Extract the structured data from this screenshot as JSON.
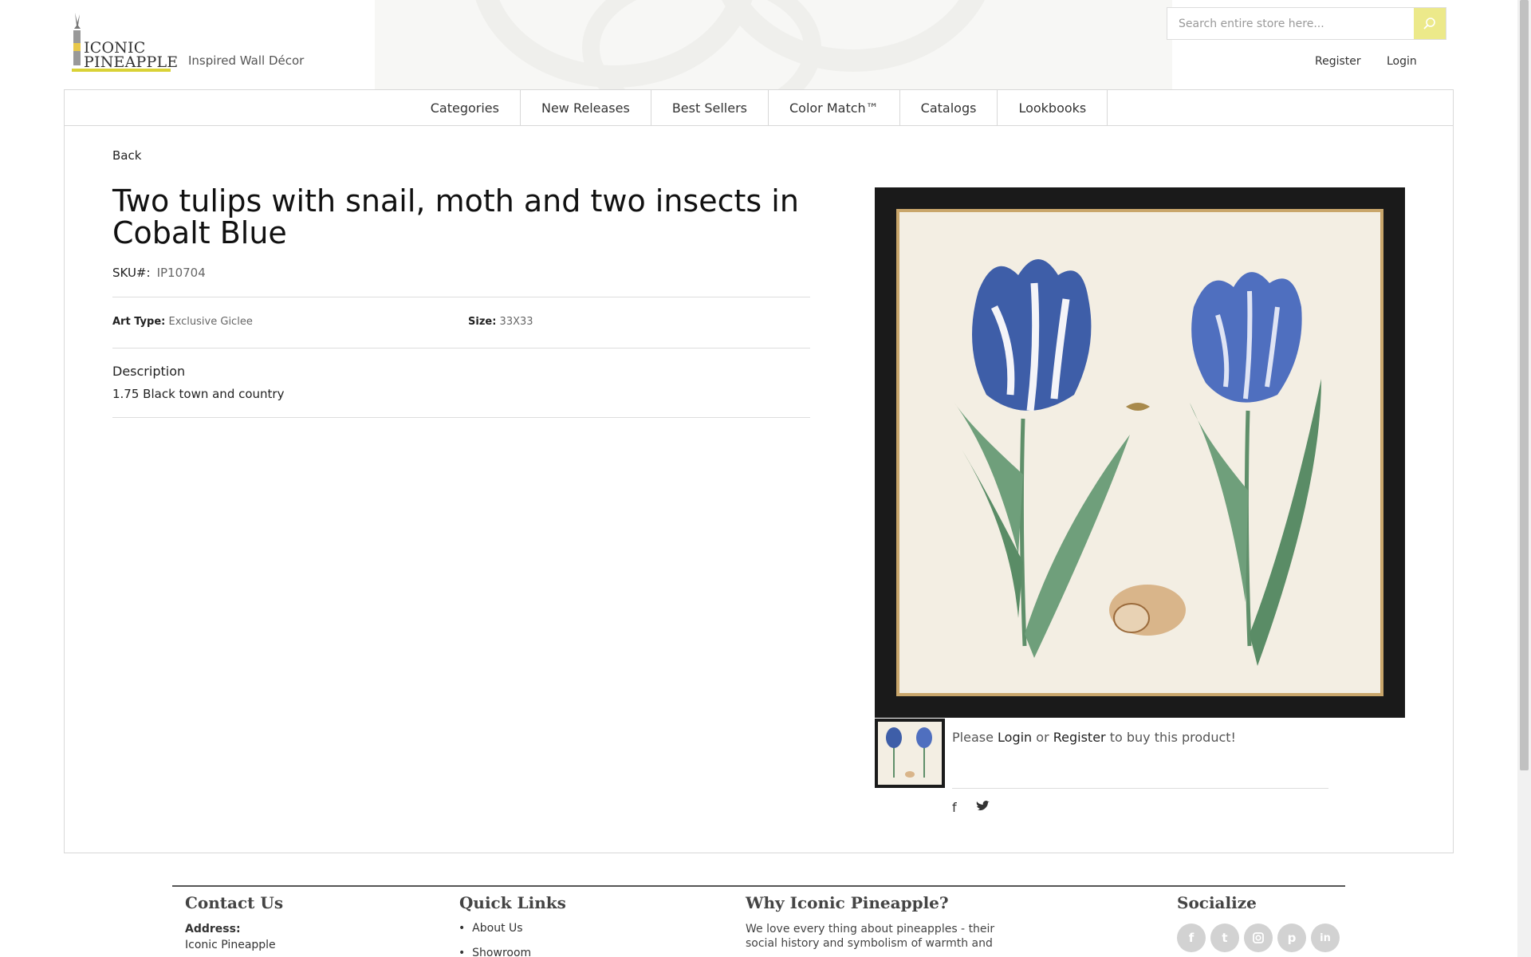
{
  "brand": {
    "logo_line1": "ICONIC",
    "logo_line2": "PINEAPPLE",
    "tagline": "Inspired Wall Décor",
    "accent_color": "#d9d236"
  },
  "header": {
    "search_placeholder": "Search entire store here...",
    "register": "Register",
    "login": "Login"
  },
  "nav": {
    "items": [
      "Categories",
      "New Releases",
      "Best Sellers",
      "Color Match™",
      "Catalogs",
      "Lookbooks"
    ]
  },
  "product": {
    "back": "Back",
    "title": "Two tulips with snail, moth and two insects in Cobalt Blue",
    "sku_label": "SKU#:",
    "sku_value": "IP10704",
    "art_type_label": "Art Type:",
    "art_type_value": "Exclusive Giclee",
    "size_label": "Size:",
    "size_value": "33X33",
    "description_heading": "Description",
    "description_text": "1.75 Black town and country",
    "buy_prefix": "Please",
    "buy_login": "Login",
    "buy_or": "or",
    "buy_register": "Register",
    "buy_suffix": "to buy this product!",
    "share_icons": [
      "facebook-icon",
      "twitter-icon"
    ]
  },
  "footer": {
    "contact_heading": "Contact Us",
    "address_label": "Address:",
    "address_line1": "Iconic Pineapple",
    "quick_links_heading": "Quick Links",
    "quick_links": [
      "About Us",
      "Showroom"
    ],
    "why_heading": "Why Iconic Pineapple?",
    "why_text": "We love every thing about pineapples - their social history and symbolism of warmth and",
    "socialize_heading": "Socialize",
    "social_icons": [
      "facebook-icon",
      "twitter-icon",
      "instagram-icon",
      "pinterest-icon",
      "linkedin-icon"
    ]
  }
}
